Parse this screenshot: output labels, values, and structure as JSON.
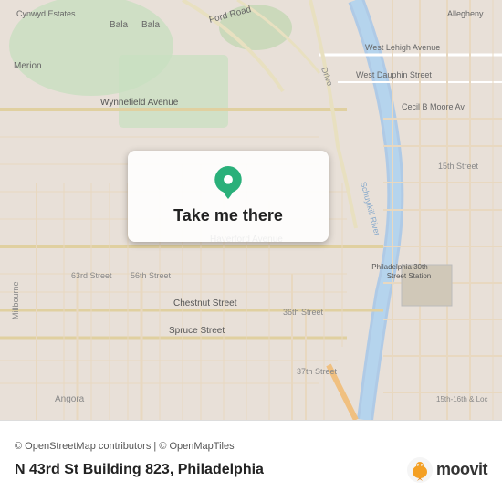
{
  "map": {
    "attribution": "© OpenStreetMap contributors | © OpenMapTiles",
    "location_name": "N 43rd St Building 823, Philadelphia",
    "take_me_there_label": "Take me there",
    "pin_color": "#2ab07a",
    "moovit_text": "moovit",
    "bg_color": "#e8e0d8"
  },
  "streets": [
    "Cynwyd Estates",
    "Bala",
    "Merion",
    "Ford Road",
    "West Lehigh Avenue",
    "West Dauphin Street",
    "Wynnefield Avenue",
    "Cecil B Moore Av",
    "Haverford Avenue",
    "Millbourne",
    "63rd Street",
    "56th Street",
    "Chestnut Street",
    "Spruce Street",
    "36th Street",
    "37th Street",
    "Philadelphia 30th Street Station",
    "15th Street",
    "Schuylkill River",
    "Angora",
    "15th-16th & Loc"
  ]
}
